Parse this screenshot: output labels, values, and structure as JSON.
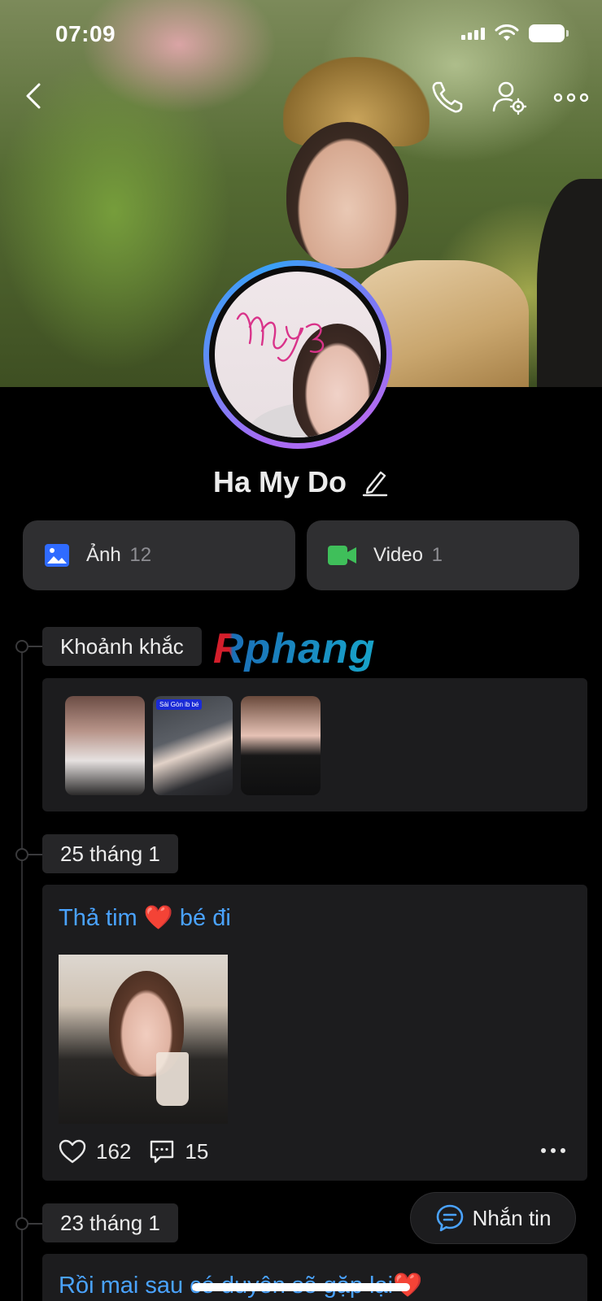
{
  "status_bar": {
    "time": "07:09"
  },
  "profile": {
    "name": "Ha My Do"
  },
  "media": {
    "photos": {
      "label": "Ảnh",
      "count": "12"
    },
    "videos": {
      "label": "Video",
      "count": "1"
    }
  },
  "watermark": "Rphang",
  "moments": {
    "label": "Khoảnh khắc",
    "thumbs": [
      {
        "tag": ""
      },
      {
        "tag": "Sài Gòn ib bé"
      },
      {
        "tag": ""
      }
    ]
  },
  "posts": [
    {
      "date": "25 tháng 1",
      "text": "Thả tim ❤️ bé đi",
      "likes": "162",
      "comments": "15"
    },
    {
      "date": "23 tháng 1",
      "text": "Rồi mai sau có duyên sẽ gặp lại❤️"
    }
  ],
  "fab": {
    "label": "Nhắn tin"
  },
  "colors": {
    "accent": "#4aa3ff",
    "photo_icon": "#2f6bff",
    "video_icon": "#3fbf5a"
  }
}
